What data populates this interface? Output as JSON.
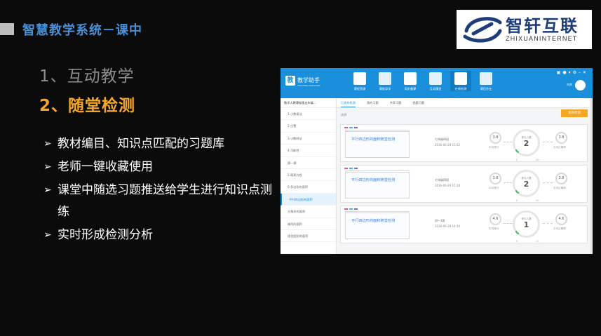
{
  "slide": {
    "header_title": "智慧教学系统－课中",
    "logo_cn": "智轩互联",
    "logo_en": "ZHIXUANINTERNET",
    "section1": "1、互动教学",
    "section2": "2、随堂检测",
    "bullets": [
      "教材编目、知识点匹配的习题库",
      "老师一键收藏使用",
      "课堂中随选习题推送给学生进行知识点测练",
      "实时形成检测分析"
    ],
    "accent_color": "#f3a52c",
    "header_color": "#4a8fd6"
  },
  "app": {
    "name": "教学助手",
    "name_sub": "TEACHING ASSISTANT",
    "user": "刘邦",
    "nav": [
      {
        "label": "课程资源",
        "icon": "book-icon"
      },
      {
        "label": "课前导学",
        "icon": "house-icon"
      },
      {
        "label": "同步备课",
        "icon": "pencil-icon"
      },
      {
        "label": "互动课堂",
        "icon": "monitor-icon"
      },
      {
        "label": "在线检测",
        "icon": "checklist-icon",
        "active": true
      },
      {
        "label": "课后作业",
        "icon": "tree-icon"
      }
    ],
    "sidebar_head": "数学人教课标版五年级...",
    "sidebar_items": [
      "1.小数乘法",
      "2.位置",
      "3.小数除法",
      "4.可能性",
      "掷一掷",
      "5.简易方程",
      "6.多边形的面积",
      "平行四边形的面积",
      "三角形的面积",
      "梯形的面积",
      "组合图形的面积"
    ],
    "tabs": [
      "已发布检测",
      "我的习题",
      "共享习题",
      "错题习题"
    ],
    "filter_label": "选择",
    "publish_button": "发布检测",
    "cards": [
      {
        "title": "平行四边形的面积随堂检测",
        "class": "七年级四班",
        "date": "2016-06-29 15:52",
        "score_left": "3.8",
        "score_left_label": "平均得分",
        "participants": "2",
        "participants_label": "参与人数",
        "score_right": "3.8",
        "score_right_label": "平均正确率",
        "scale_min": "0",
        "scale_max": "50"
      },
      {
        "title": "平行四边形的面积随堂检测",
        "class": "七年级四班",
        "date": "2016-06-29 15:18",
        "score_left": "3.8",
        "score_left_label": "平均得分",
        "participants": "2",
        "participants_label": "参与人数",
        "score_right": "3.8",
        "score_right_label": "平均正确率",
        "scale_min": "0",
        "scale_max": "50"
      },
      {
        "title": "平行四边形的面积随堂检测",
        "class": "初一1班",
        "date": "2016-06-28 14:10",
        "score_left": "4.6",
        "score_left_label": "平均得分",
        "participants": "1",
        "participants_label": "参与人数",
        "score_right": "4.6",
        "score_right_label": "平均正确率",
        "scale_min": "0",
        "scale_max": "11"
      }
    ]
  }
}
